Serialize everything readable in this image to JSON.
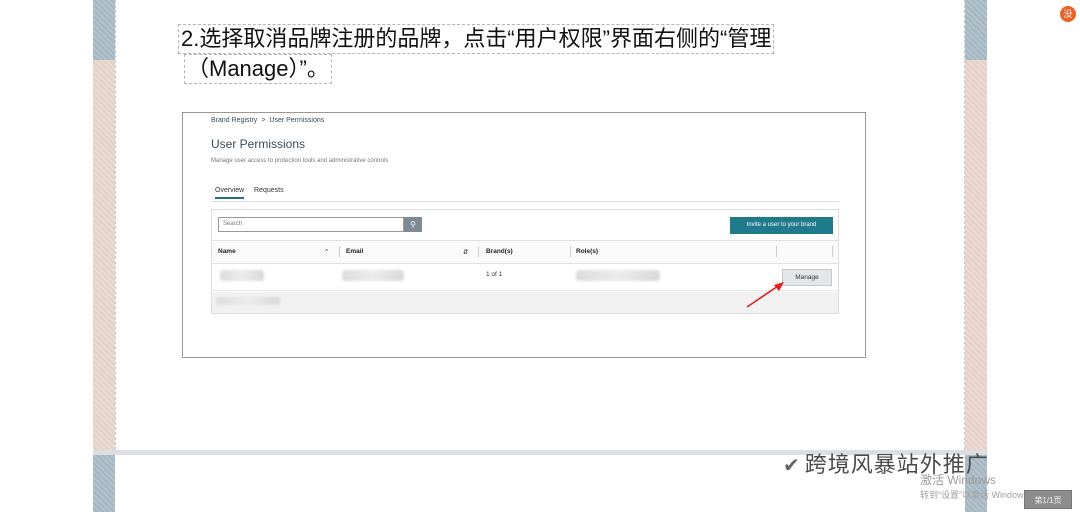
{
  "instruction": {
    "line1": "2.选择取消品牌注册的品牌，点击“用户权限”界面右侧的“管理",
    "line2": "（Manage）”。"
  },
  "screenshot": {
    "breadcrumb": {
      "parent": "Brand Registry",
      "separator": ">",
      "current": "User Permissions"
    },
    "title": "User Permissions",
    "description": "Manage user access to protection tools and administrative controls",
    "tabs": [
      {
        "label": "Overview",
        "active": true
      },
      {
        "label": "Requests",
        "active": false
      }
    ],
    "search": {
      "placeholder": "Search",
      "icon": "search-icon"
    },
    "invite_label": "Invite a user to your brand",
    "columns": {
      "name": "Name",
      "email": "Email",
      "brands": "Brand(s)",
      "roles": "Role(s)"
    },
    "row": {
      "brand_count": "1 of 1",
      "manage_label": "Manage"
    }
  },
  "overlay": {
    "watermark": "跨境风暴站外推广",
    "activation_title": "激活 Windows",
    "activation_hint": "转到“设置”以激活 Windows。",
    "page_button": "第1/1页",
    "corner_icon": "没"
  },
  "colors": {
    "accent": "#1f7a8c",
    "arrow": "#e02020",
    "side_panel": "#ead7cd"
  }
}
